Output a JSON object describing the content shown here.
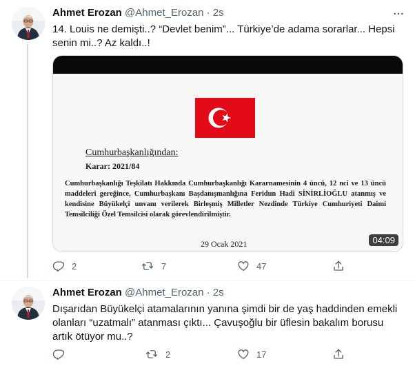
{
  "colors": {
    "text": "#0f1419",
    "muted": "#536471",
    "border": "#cfd9de",
    "flag_red": "#e30a17"
  },
  "tweets": [
    {
      "display_name": "Ahmet Erozan",
      "handle": "@Ahmet_Erozan",
      "separator": "·",
      "time": "2s",
      "text_line1": "14. Louis ne demişti..? “Devlet benim”... Türkiye’de adama sorarlar... Hepsi",
      "text_line2": "senin mi..? Az kaldı..!",
      "media": {
        "doc_heading": "Cumhurbaşkanlığından:",
        "doc_decision": "Karar: 2021/84",
        "doc_paragraph": "Cumhurbaşkanlığı Teşkilatı Hakkında Cumhurbaşkanlığı Kararnamesinin 4 üncü, 12 nci ve 13 üncü maddeleri gereğince, Cumhurbaşkanı Başdanışmanlığına Feridun Hadi SİNİRLİOĞLU atanmış ve kendisine Büyükelçi unvanı verilerek Birleşmiş Milletler Nezdinde Türkiye Cumhuriyeti Daimi Temsilciliği Özel Temsilcisi olarak görevlendirilmiştir.",
        "doc_date": "29 Ocak 2021",
        "duration": "04:09"
      },
      "replies": "2",
      "retweets": "7",
      "likes": "47",
      "icons": [
        "reply-icon",
        "retweet-icon",
        "like-icon",
        "share-icon",
        "more-icon"
      ]
    },
    {
      "display_name": "Ahmet Erozan",
      "handle": "@Ahmet_Erozan",
      "separator": "·",
      "time": "2s",
      "text_line1": "Dışarıdan Büyükelçi atamalarının yanına şimdi bir de yaş haddinden emekli",
      "text_line2": "olanları “uzatmalı” atanması çıktı... Çavuşoğlu bir üflesin bakalım borusu",
      "text_line3": "artık ötüyor mu..?",
      "replies": "",
      "retweets": "2",
      "likes": "17",
      "icons": [
        "reply-icon",
        "retweet-icon",
        "like-icon",
        "share-icon",
        "more-icon"
      ]
    }
  ]
}
